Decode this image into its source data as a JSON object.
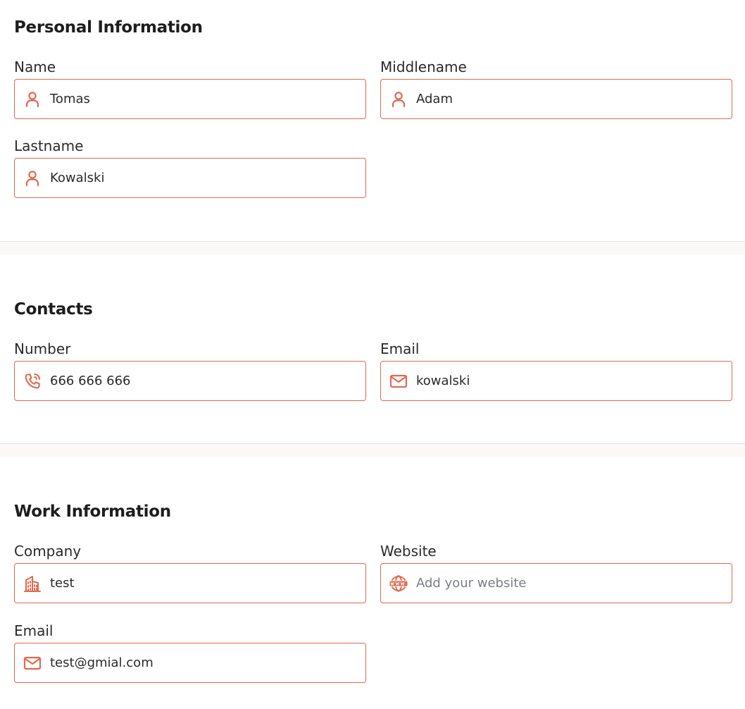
{
  "personal": {
    "title": "Personal Information",
    "name": {
      "label": "Name",
      "value": "Tomas",
      "icon": "user-icon"
    },
    "middlename": {
      "label": "Middlename",
      "value": "Adam",
      "icon": "user-icon"
    },
    "lastname": {
      "label": "Lastname",
      "value": "Kowalski",
      "icon": "user-icon"
    }
  },
  "contacts": {
    "title": "Contacts",
    "number": {
      "label": "Number",
      "value": "666 666 666",
      "icon": "phone-icon"
    },
    "email": {
      "label": "Email",
      "value": "kowalski",
      "icon": "mail-icon"
    }
  },
  "work": {
    "title": "Work Information",
    "company": {
      "label": "Company",
      "value": "test",
      "icon": "building-icon"
    },
    "website": {
      "label": "Website",
      "value": "",
      "placeholder": "Add your website",
      "icon": "globe-www-icon"
    },
    "email": {
      "label": "Email",
      "value": "test@gmial.com",
      "icon": "mail-icon"
    }
  },
  "colors": {
    "accent": "#e06a4f",
    "divider_bg": "#fbf9f7"
  }
}
